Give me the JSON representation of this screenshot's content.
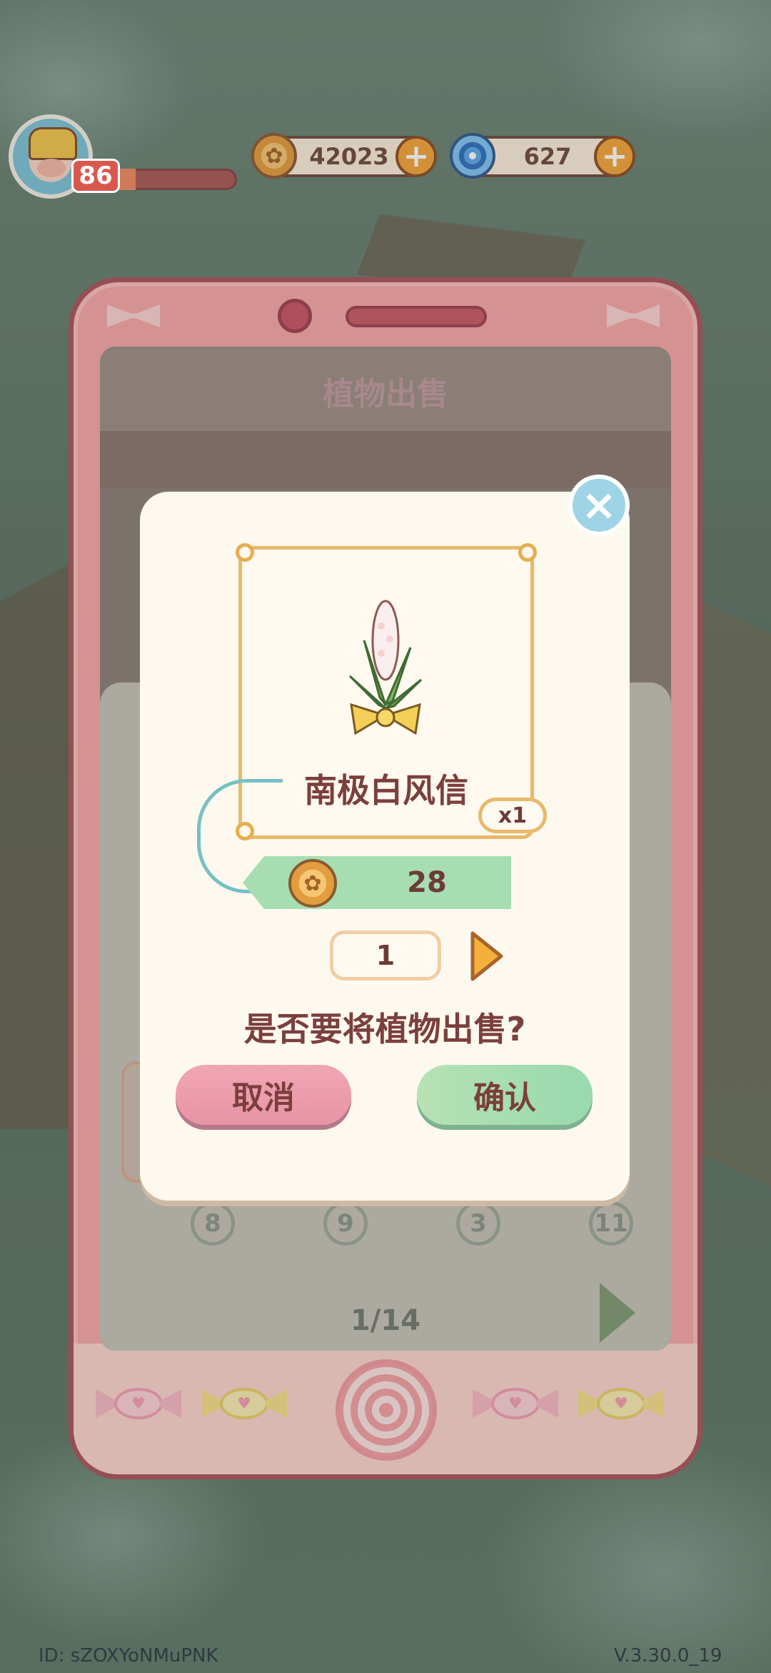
{
  "hud": {
    "level": "86",
    "xp_progress": 0.22,
    "coins": "42023",
    "gems": "627",
    "coin_plus": "+",
    "gem_plus": "+"
  },
  "screen": {
    "title": "植物出售",
    "page_indicator": "1/14",
    "slot_counts": [
      "8",
      "9",
      "3",
      "11"
    ]
  },
  "dialog": {
    "plant_name": "南极白风信",
    "owned_qty": "x1",
    "price": "28",
    "sell_qty": "1",
    "question": "是否要将植物出售?",
    "cancel_label": "取消",
    "confirm_label": "确认",
    "close_icon": "×"
  },
  "footer": {
    "id": "ID:  sZOXYoNMuPNK",
    "version": "V.3.30.0_19"
  },
  "colors": {
    "phone_pink": "#f7a7a6",
    "dialog_bg": "#fdf9ef",
    "text_brown": "#7b3f3c",
    "confirm_green": "#97d9ad",
    "cancel_pink": "#e894a5"
  }
}
